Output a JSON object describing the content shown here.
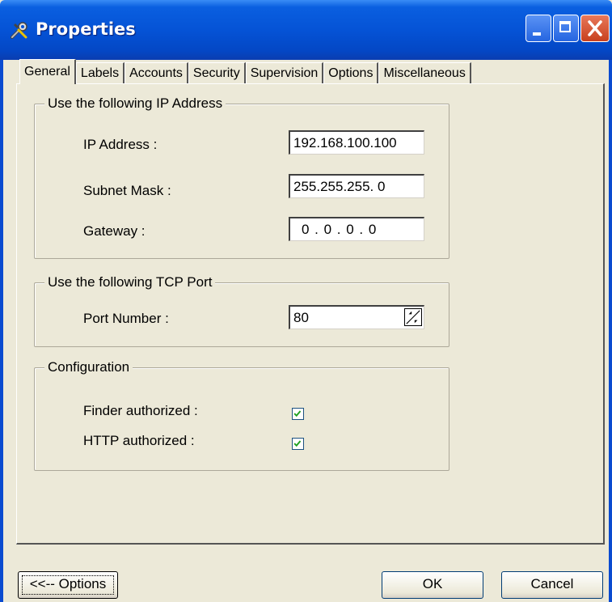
{
  "window": {
    "title": "Properties",
    "icon": "properties-tools-icon",
    "controls": [
      "minimize-icon",
      "maximize-icon",
      "close-icon"
    ]
  },
  "tabs": [
    {
      "label": "General",
      "active": true
    },
    {
      "label": "Labels",
      "active": false
    },
    {
      "label": "Accounts",
      "active": false
    },
    {
      "label": "Security",
      "active": false
    },
    {
      "label": "Supervision",
      "active": false
    },
    {
      "label": "Options",
      "active": false
    },
    {
      "label": "Miscellaneous",
      "active": false
    }
  ],
  "ip_group": {
    "title": "Use the following IP Address",
    "ip_label": "IP Address :",
    "ip_value": "192.168.100.100",
    "mask_label": "Subnet Mask :",
    "mask_value": "255.255.255. 0",
    "gateway_label": "Gateway :",
    "gateway_value": "0 . 0 . 0 . 0"
  },
  "tcp_group": {
    "title": "Use the following TCP Port",
    "port_label": "Port Number :",
    "port_value": "80"
  },
  "config_group": {
    "title": "Configuration",
    "finder_label": "Finder authorized :",
    "finder_checked": true,
    "http_label": "HTTP authorized :",
    "http_checked": true
  },
  "buttons": {
    "options": "<<-- Options",
    "ok": "OK",
    "cancel": "Cancel"
  },
  "colors": {
    "titlebar": "#0553d6",
    "face": "#ece9d8",
    "check": "#21a121"
  }
}
